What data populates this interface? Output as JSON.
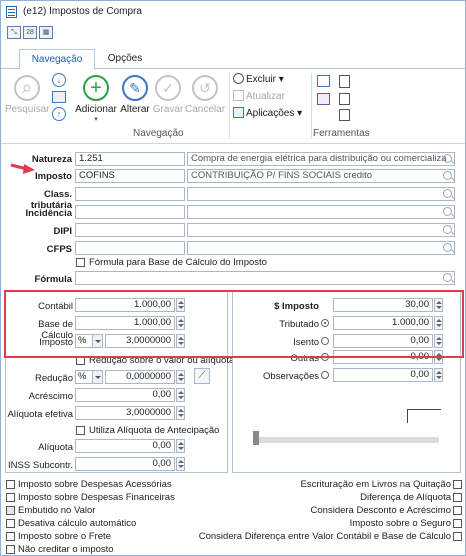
{
  "window": {
    "title": "(e12) Impostos de Compra"
  },
  "tabs": [
    {
      "label": "Navegação"
    },
    {
      "label": "Opções"
    }
  ],
  "ribbon": {
    "pesquisar": "Pesquisar",
    "adicionar": "Adicionar",
    "alterar": "Alterar",
    "gravar": "Gravar",
    "cancelar": "Cancelar",
    "excluir": "Excluir",
    "atualizar": "Atualizar",
    "aplicacoes": "Aplicações",
    "group_navegacao": "Navegação",
    "group_ferramentas": "Ferramentas"
  },
  "form": {
    "natureza_label": "Natureza",
    "natureza_value": "1.251",
    "natureza_desc": "Compra de energia elétrica para distribuição ou comercializa",
    "imposto_label": "Imposto",
    "imposto_value": "COFINS",
    "imposto_desc": "CONTRIBUIÇÃO P/ FINS SOCIAIS credito",
    "class_label": "Class. tributária",
    "incidencia_label": "Incidência",
    "dipi_label": "DIPI",
    "cfps_label": "CFPS",
    "formula_base_check": "Fórmula para Base de Cálculo do Imposto",
    "formula_label": "Fórmula"
  },
  "left": {
    "contabil_label": "Contábil",
    "contabil_value": "1.000,00",
    "base_label": "Base de Cálculo",
    "base_value": "1.000,00",
    "imposto_label": "Imposto",
    "imposto_unit": "%",
    "imposto_value": "3,0000000",
    "reducao_check": "Redução sobre o valor ou alíquota",
    "reducao_label": "Redução",
    "reducao_unit": "%",
    "reducao_value": "0,0000000",
    "acrescimo_label": "Acréscimo",
    "acrescimo_value": "0,00",
    "aliquota_efetiva_label": "Alíquota efetiva",
    "aliquota_efetiva_value": "3,0000000",
    "antecipacao_check": "Utiliza Alíquota de Antecipação",
    "aliquota_label": "Alíquota",
    "aliquota_value": "0,00",
    "inss_label": "INSS Subcontr.",
    "inss_value": "0,00"
  },
  "right": {
    "simposto_label": "$ Imposto",
    "simposto_value": "30,00",
    "tributado_label": "Tributado",
    "tributado_value": "1.000,00",
    "isento_label": "Isento",
    "isento_value": "0,00",
    "outras_label": "Outras",
    "outras_value": "0,00",
    "observacoes_label": "Observações",
    "observacoes_value": "0,00"
  },
  "options_left": [
    "Imposto sobre Despesas Acessórias",
    "Imposto sobre Despesas Financeiras",
    "Embutido no Valor",
    "Desativa cálculo automático",
    "Imposto sobre o Frete",
    "Não creditar o imposto"
  ],
  "options_right": [
    "Escrituração em Livros na Quitação",
    "Diferença de Alíquota",
    "Considera Desconto e Acréscimo",
    "Imposto sobre o Seguro",
    "Considera Diferença entre Valor Contábil e Base de Cálculo"
  ],
  "colors": {
    "accent": "#1f5fa8",
    "highlight": "#e23c4c",
    "add": "#2aa24a"
  }
}
